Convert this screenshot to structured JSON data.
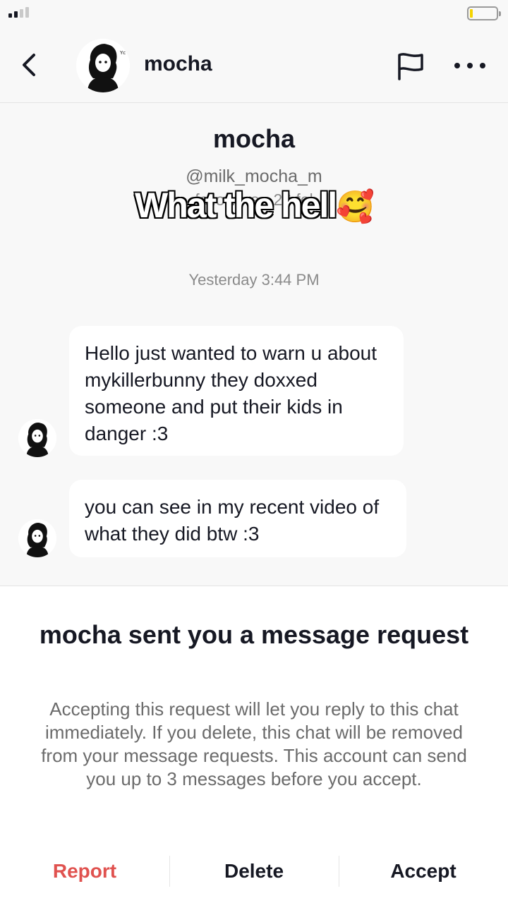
{
  "header": {
    "contact_name": "mocha",
    "back_icon": "chevron-left-icon",
    "flag_icon": "flag-icon",
    "more_icon": "ellipsis-icon"
  },
  "profile": {
    "name": "mocha",
    "handle": "@milk_mocha_m",
    "stats_partial": "followers · 26 fol"
  },
  "overlay_caption": {
    "text": "What the hell",
    "emoji": "🥰"
  },
  "chat": {
    "timestamp": "Yesterday 3:44 PM",
    "messages": [
      {
        "text": "Hello just wanted to warn u about mykillerbunny they doxxed someone and put their kids in danger :3"
      },
      {
        "text": "you can see in my recent video of what they did btw :3"
      }
    ]
  },
  "request": {
    "title": "mocha sent you a message request",
    "description": "Accepting this request will let you reply to this chat immediately. If you delete, this chat will be removed from your message requests. This account can send you up to 3 messages before you accept.",
    "report_label": "Report",
    "delete_label": "Delete",
    "accept_label": "Accept"
  },
  "colors": {
    "report": "#e0524f",
    "background": "#f8f8f8",
    "bubble": "#ffffff",
    "battery_level": "#f5d400"
  }
}
